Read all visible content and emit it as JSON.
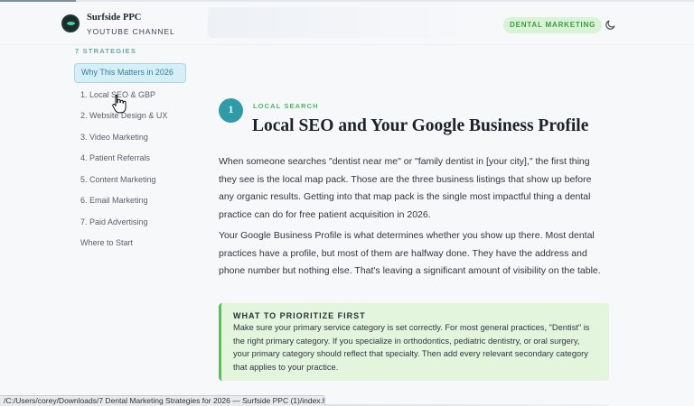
{
  "header": {
    "brand_name": "Surfside PPC",
    "brand_sub": "YOUTUBE CHANNEL",
    "badge": "DENTAL MARKETING",
    "theme_toggle_icon": "moon-icon",
    "logo_icon": "logo-icon"
  },
  "sidebar": {
    "title": "7 STRATEGIES",
    "items": [
      {
        "label": "Why This Matters in 2026",
        "active": true
      },
      {
        "label": "1. Local SEO & GBP",
        "active": false
      },
      {
        "label": "2. Website Design & UX",
        "active": false
      },
      {
        "label": "3. Video Marketing",
        "active": false
      },
      {
        "label": "4. Patient Referrals",
        "active": false
      },
      {
        "label": "5. Content Marketing",
        "active": false
      },
      {
        "label": "6. Email Marketing",
        "active": false
      },
      {
        "label": "7. Paid Advertising",
        "active": false
      },
      {
        "label": "Where to Start",
        "active": false
      }
    ]
  },
  "main": {
    "section_number": "1",
    "eyebrow": "LOCAL SEARCH",
    "title": "Local SEO and Your Google Business Profile",
    "paragraph1": "When someone searches \"dentist near me\" or \"family dentist in [your city],\" the first thing they see is the local map pack. Those are the three business listings that show up before any organic results. Getting into that map pack is the single most impactful thing a dental practice can do for free patient acquisition in 2026.",
    "paragraph2": "Your Google Business Profile is what determines whether you show up there. Most dental practices have a profile, but most of them are halfway done. They have the address and phone number but nothing else. That's leaving a significant amount of visibility on the table.",
    "callout": {
      "title": "WHAT TO PRIORITIZE FIRST",
      "body": "Make sure your primary service category is set correctly. For most general practices, \"Dentist\" is the right primary category. If you specialize in orthodontics, pediatric dentistry, or oral surgery, your primary category should reflect that specialty. Then add every relevant secondary category that applies to your practice."
    }
  },
  "status_bar": {
    "url": "/C:/Users/corey/Downloads/7 Dental Marketing Strategies for 2026 — Surfside PPC (1)/index.html#intro"
  },
  "colors": {
    "accent_teal": "#2f9aa8",
    "accent_green": "#4fb56a",
    "active_nav_bg": "#d6eef6",
    "callout_bg": "#e4f5de"
  }
}
